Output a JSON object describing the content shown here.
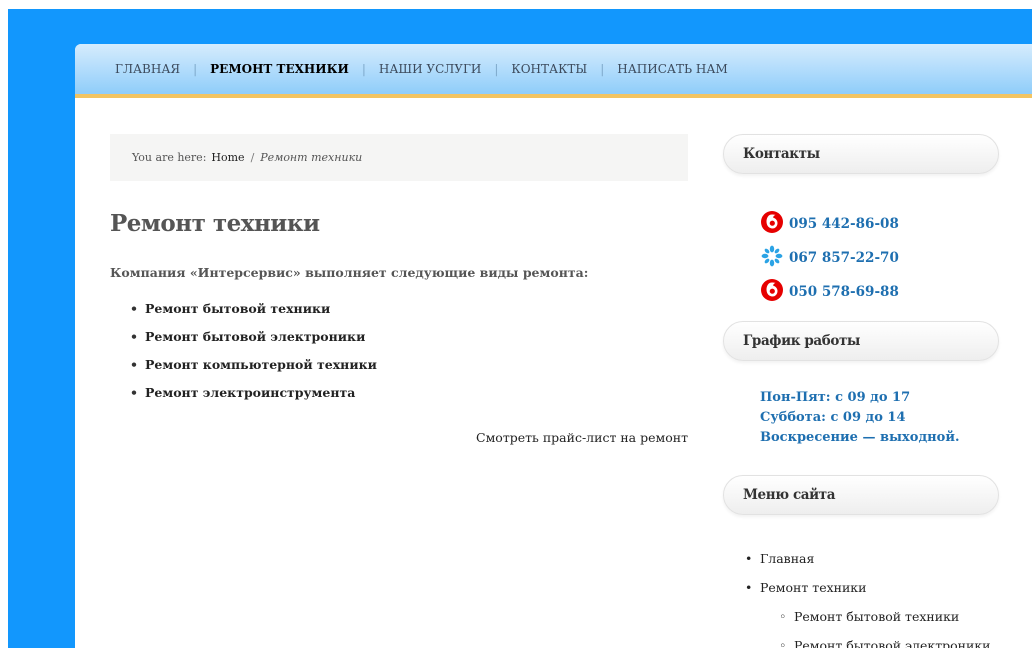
{
  "nav": {
    "items": [
      {
        "label": "ГЛАВНАЯ",
        "active": false
      },
      {
        "label": "РЕМОНТ ТЕХНИКИ",
        "active": true
      },
      {
        "label": "НАШИ УСЛУГИ",
        "active": false
      },
      {
        "label": "КОНТАКТЫ",
        "active": false
      },
      {
        "label": "НАПИСАТЬ НАМ",
        "active": false
      }
    ],
    "separator": "|"
  },
  "breadcrumb": {
    "prefix": "You are here:",
    "home": "Home",
    "separator": "/",
    "current": "Ремонт техники"
  },
  "main": {
    "title": "Ремонт техники",
    "intro": "Компания «Интерсервис» выполняет следующие виды ремонта:",
    "services": [
      "Ремонт бытовой техники",
      "Ремонт бытовой электроники",
      "Ремонт компьютерной техники",
      "Ремонт электроинструмента"
    ],
    "price_link": "Смотреть прайс-лист на ремонт"
  },
  "sidebar": {
    "contacts": {
      "title": "Контакты",
      "phones": [
        {
          "icon": "vodafone-icon",
          "number": "095 442-86-08"
        },
        {
          "icon": "kyivstar-icon",
          "number": "067 857-22-70"
        },
        {
          "icon": "vodafone-icon",
          "number": "050 578-69-88"
        }
      ]
    },
    "schedule": {
      "title": "График работы",
      "lines": [
        "Пон-Пят: с 09 до 17",
        "Суббота: с 09 до 14",
        "Воскресение — выходной."
      ]
    },
    "menu": {
      "title": "Меню сайта",
      "items": [
        "Главная",
        "Ремонт техники"
      ],
      "subitems": [
        "Ремонт бытовой техники",
        "Ремонт бытовой электроники"
      ]
    }
  },
  "colors": {
    "background_blue": "#1297fd",
    "nav_gradient_top": "#d6ecfd",
    "nav_gradient_bottom": "#8fcdfa",
    "nav_underline": "#f2c462",
    "link_blue": "#1e6fb0",
    "vodafone_red": "#e60000",
    "kyivstar_blue": "#2ba3e5"
  }
}
